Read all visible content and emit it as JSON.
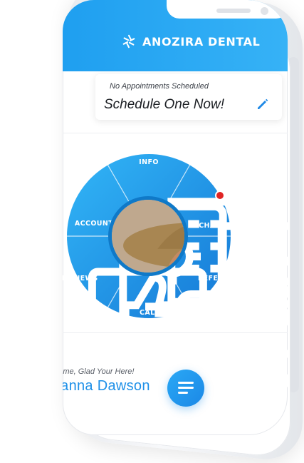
{
  "header": {
    "brand_name": "ANOZIRA DENTAL",
    "brand_color": "#1f9ff0"
  },
  "appointment": {
    "status_text": "No Appointments Scheduled",
    "cta_text": "Schedule One Now!",
    "edit_icon": "pencil-icon"
  },
  "menu_wheel": {
    "color": "#1e92e6",
    "items": [
      {
        "label": "INFO",
        "icon": "map-building-icon"
      },
      {
        "label": "CHAT",
        "icon": "chat-bubbles-icon",
        "has_notification": true
      },
      {
        "label": "REFER",
        "icon": "people-referral-icon"
      },
      {
        "label": "CALL",
        "icon": "phone-call-icon"
      },
      {
        "label": "REVIEWS",
        "icon": "thumbs-up-screen-icon"
      },
      {
        "label": "ACCOUNT",
        "icon": "account-settings-icon"
      }
    ],
    "avatar": "user-profile-photo"
  },
  "footer": {
    "welcome_text": "Welcome, Glad Your Here!",
    "user_name": "Johanna Dawson",
    "menu_icon": "hamburger-menu-icon"
  }
}
